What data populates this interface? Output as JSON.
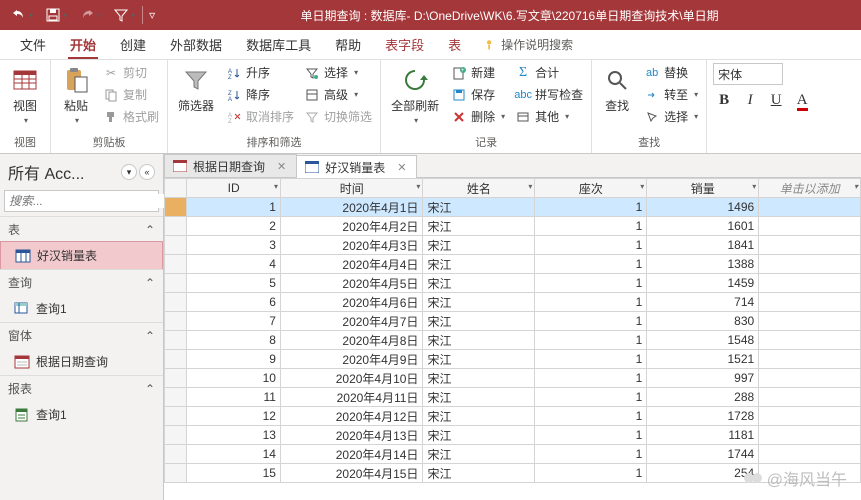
{
  "titlebar": {
    "title": "单日期查询 : 数据库- D:\\OneDrive\\WK\\6.写文章\\220716单日期查询技术\\单日期"
  },
  "menu": {
    "file": "文件",
    "home": "开始",
    "create": "创建",
    "external": "外部数据",
    "dbtools": "数据库工具",
    "help": "帮助",
    "ctx_fields": "表字段",
    "ctx_table": "表",
    "tell": "操作说明搜索"
  },
  "ribbon": {
    "views": {
      "label": "视图",
      "big": "视图"
    },
    "clipboard": {
      "label": "剪贴板",
      "paste": "粘贴",
      "cut": "剪切",
      "copy": "复制",
      "fmtpaint": "格式刷"
    },
    "sortfilter": {
      "label": "排序和筛选",
      "filter": "筛选器",
      "asc": "升序",
      "desc": "降序",
      "clearsort": "取消排序",
      "selection": "选择",
      "advanced": "高级",
      "toggle": "切换筛选"
    },
    "records": {
      "label": "记录",
      "refresh": "全部刷新",
      "new": "新建",
      "save": "保存",
      "delete": "删除",
      "totals": "合计",
      "spell": "拼写检查",
      "more": "其他"
    },
    "find": {
      "label": "查找",
      "find": "查找",
      "replace": "替换",
      "goto": "转至",
      "select": "选择"
    },
    "font": {
      "family": "宋体"
    }
  },
  "nav": {
    "title": "所有 Acc...",
    "search_placeholder": "搜索...",
    "cat_tables": "表",
    "cat_queries": "查询",
    "cat_forms": "窗体",
    "cat_reports": "报表",
    "item_table": "好汉销量表",
    "item_query": "查询1",
    "item_form": "根据日期查询",
    "item_report": "查询1"
  },
  "tabs": {
    "t1": "根据日期查询",
    "t2": "好汉销量表"
  },
  "grid": {
    "headers": {
      "id": "ID",
      "time": "时间",
      "name": "姓名",
      "seat": "座次",
      "sales": "销量",
      "add": "单击以添加"
    },
    "rows": [
      {
        "id": 1,
        "time": "2020年4月1日",
        "name": "宋江",
        "seat": 1,
        "sales": 1496
      },
      {
        "id": 2,
        "time": "2020年4月2日",
        "name": "宋江",
        "seat": 1,
        "sales": 1601
      },
      {
        "id": 3,
        "time": "2020年4月3日",
        "name": "宋江",
        "seat": 1,
        "sales": 1841
      },
      {
        "id": 4,
        "time": "2020年4月4日",
        "name": "宋江",
        "seat": 1,
        "sales": 1388
      },
      {
        "id": 5,
        "time": "2020年4月5日",
        "name": "宋江",
        "seat": 1,
        "sales": 1459
      },
      {
        "id": 6,
        "time": "2020年4月6日",
        "name": "宋江",
        "seat": 1,
        "sales": 714
      },
      {
        "id": 7,
        "time": "2020年4月7日",
        "name": "宋江",
        "seat": 1,
        "sales": 830
      },
      {
        "id": 8,
        "time": "2020年4月8日",
        "name": "宋江",
        "seat": 1,
        "sales": 1548
      },
      {
        "id": 9,
        "time": "2020年4月9日",
        "name": "宋江",
        "seat": 1,
        "sales": 1521
      },
      {
        "id": 10,
        "time": "2020年4月10日",
        "name": "宋江",
        "seat": 1,
        "sales": 997
      },
      {
        "id": 11,
        "time": "2020年4月11日",
        "name": "宋江",
        "seat": 1,
        "sales": 288
      },
      {
        "id": 12,
        "time": "2020年4月12日",
        "name": "宋江",
        "seat": 1,
        "sales": 1728
      },
      {
        "id": 13,
        "time": "2020年4月13日",
        "name": "宋江",
        "seat": 1,
        "sales": 1181
      },
      {
        "id": 14,
        "time": "2020年4月14日",
        "name": "宋江",
        "seat": 1,
        "sales": 1744
      },
      {
        "id": 15,
        "time": "2020年4月15日",
        "name": "宋江",
        "seat": 1,
        "sales": 254
      }
    ]
  },
  "watermark": "@海风当午"
}
